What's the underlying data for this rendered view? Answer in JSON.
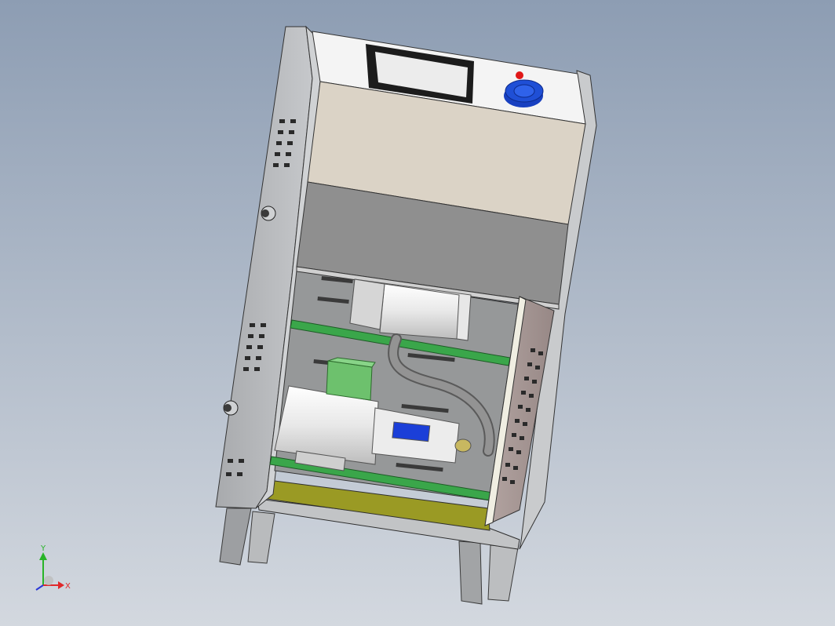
{
  "viewport": {
    "background_top": "#8d9db3",
    "background_bottom": "#d3d8df"
  },
  "triad": {
    "x_label": "X",
    "y_label": "Y",
    "x_color": "#e0282a",
    "y_color": "#28b428",
    "z_color": "#2a38d6"
  },
  "model": {
    "parts": [
      "cabinet-frame",
      "left-side-panel",
      "right-side-panel",
      "control-panel",
      "display-screen",
      "control-knob",
      "indicator-light",
      "lower-cover-panel",
      "upper-shelf-rail",
      "lower-shelf-rail",
      "pump-unit",
      "motor-unit",
      "terminal-box",
      "flexible-hose",
      "base-tray",
      "cabinet-legs"
    ],
    "colors": {
      "frame": "#b7b9bc",
      "control_panel": "#f4f4f4",
      "beige_cover": "#dbd3c6",
      "grey_cover": "#8f8f8f",
      "rail": "#3aa64a",
      "motor_body": "#f2f2f2",
      "terminal_box": "#6dc16d",
      "coupling": "#1b3fd8",
      "knob": "#1f4fd6",
      "indicator": "#e01818",
      "tray": "#9a9a24",
      "hose": "#8c8c8c",
      "right_panel": "#a39492"
    }
  }
}
